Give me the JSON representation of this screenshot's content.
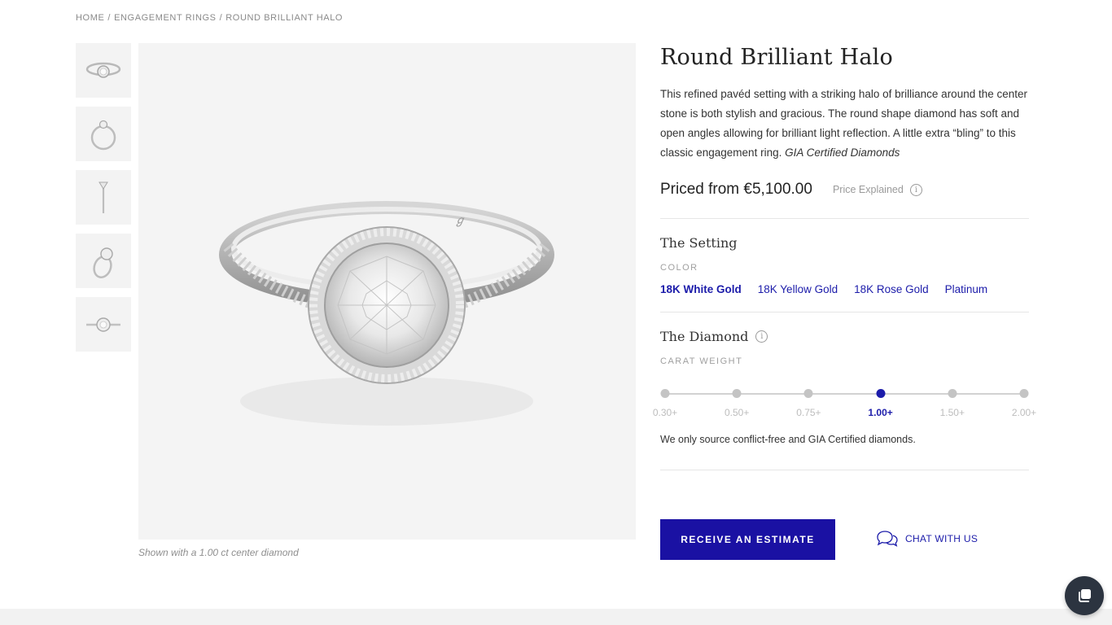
{
  "breadcrumb": {
    "home": "HOME",
    "category": "ENGAGEMENT RINGS",
    "current": "ROUND BRILLIANT HALO",
    "separator": "/"
  },
  "gallery": {
    "thumbnails": [
      "ring-front-view",
      "ring-side-view",
      "ring-profile-view",
      "ring-angle-view",
      "ring-top-view"
    ],
    "caption": "Shown with a 1.00 ct center diamond"
  },
  "product": {
    "title": "Round Brilliant Halo",
    "description": "This refined pavéd setting with a striking halo of brilliance around the center stone is both stylish and gracious. The round shape diamond has soft and open angles allowing for brilliant light reflection.  A little extra “bling” to this classic engagement ring.",
    "description_em": "GIA Certified Diamonds",
    "price": "Priced from €5,100.00",
    "price_explained": "Price Explained",
    "info_icon_glyph": "i"
  },
  "setting": {
    "title": "The Setting",
    "color_label": "COLOR",
    "colors": [
      "18K White Gold",
      "18K Yellow Gold",
      "18K Rose Gold",
      "Platinum"
    ],
    "selected_color": "18K White Gold"
  },
  "diamond": {
    "title": "The Diamond",
    "carat_label": "CARAT WEIGHT",
    "carats": [
      "0.30+",
      "0.50+",
      "0.75+",
      "1.00+",
      "1.50+",
      "2.00+"
    ],
    "selected_carat": "1.00+",
    "note": "We only source conflict-free and GIA Certified diamonds."
  },
  "actions": {
    "estimate_button": "RECEIVE AN ESTIMATE",
    "chat_link": "CHAT WITH US"
  },
  "colors_ui": {
    "accent": "#1a11a3",
    "link": "#1c1caa",
    "muted": "#9a9a9a",
    "image_bg": "#f4f4f4",
    "chat_bubble": "#2c3440"
  },
  "icons": {
    "info": "info-circle-icon",
    "chat": "speech-bubbles-icon",
    "messenger": "messenger-icon"
  }
}
